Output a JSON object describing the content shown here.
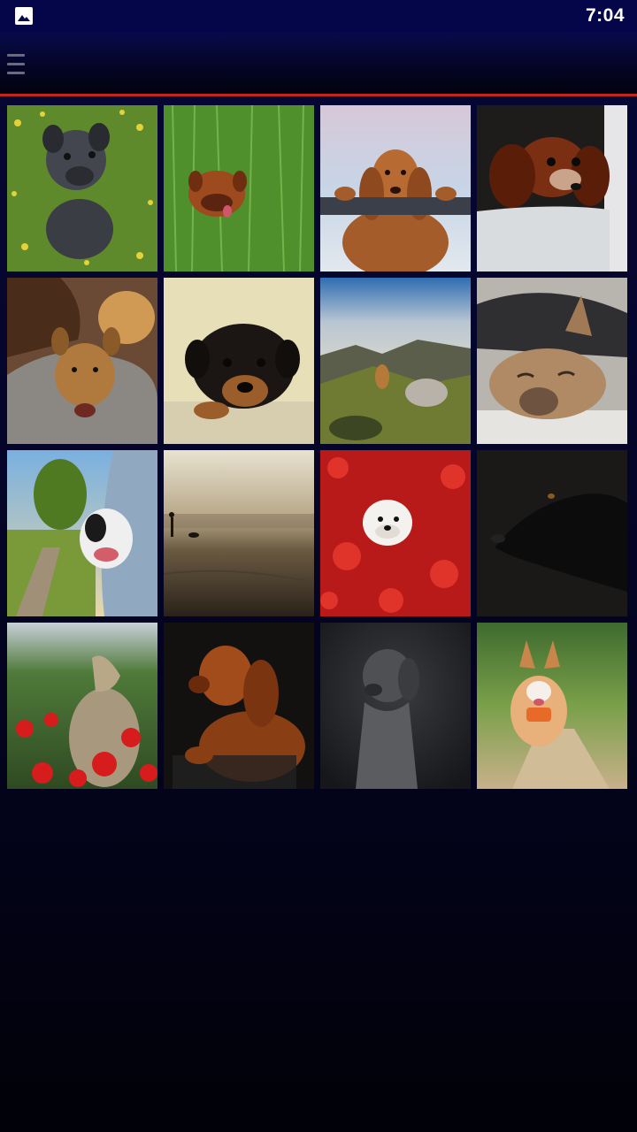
{
  "status_bar": {
    "time": "7:04",
    "notification_icon": "image-icon"
  },
  "app_bar": {
    "menu_icon": "hamburger-menu-icon"
  },
  "colors": {
    "status_bar": "#05064a",
    "accent_line": "#c0261e",
    "background_top": "#060736",
    "background_bottom": "#010108"
  },
  "gallery": {
    "photos": [
      {
        "subject": "pug-puppy-in-flowers",
        "palette": "green-yellow"
      },
      {
        "subject": "dogue-de-bordeaux-in-grass",
        "palette": "green"
      },
      {
        "subject": "cocker-spaniel-on-fence",
        "palette": "snow-brown"
      },
      {
        "subject": "cavalier-spaniel-in-tub",
        "palette": "dark-brown"
      },
      {
        "subject": "puppies-in-bag",
        "palette": "tan-gray"
      },
      {
        "subject": "rottweiler-puppy",
        "palette": "cream-black"
      },
      {
        "subject": "dog-on-mountain",
        "palette": "sky-rock"
      },
      {
        "subject": "french-bulldog-sleeping",
        "palette": "fawn-gray"
      },
      {
        "subject": "bulldog-in-car-window",
        "palette": "blue-green"
      },
      {
        "subject": "person-and-dog-on-beach",
        "palette": "sepia"
      },
      {
        "subject": "white-dog-in-red-flowers",
        "palette": "red"
      },
      {
        "subject": "black-dog-in-shadow",
        "palette": "black"
      },
      {
        "subject": "dog-howling-in-poppies",
        "palette": "green-red"
      },
      {
        "subject": "vizsla-portrait",
        "palette": "amber-dark"
      },
      {
        "subject": "weimaraner-portrait",
        "palette": "monochrome"
      },
      {
        "subject": "corgi-running",
        "palette": "green-orange"
      }
    ]
  }
}
